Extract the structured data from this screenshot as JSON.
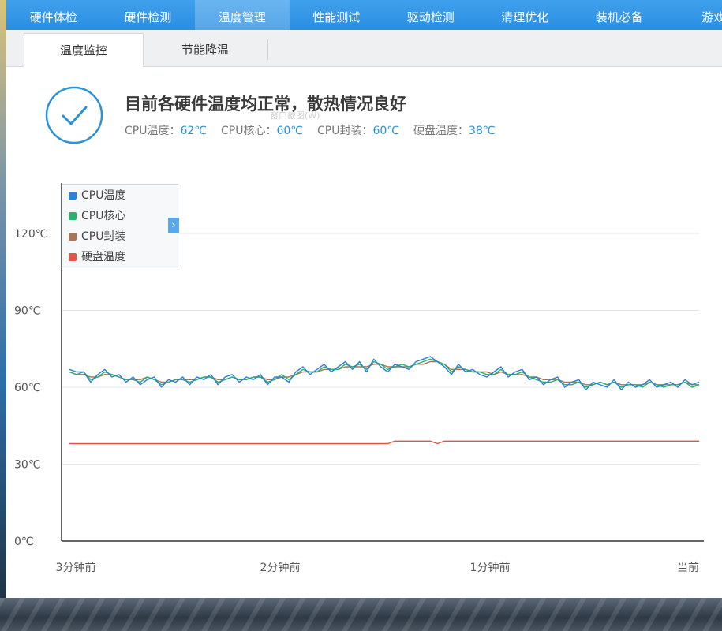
{
  "nav": {
    "items": [
      "硬件体检",
      "硬件检测",
      "温度管理",
      "性能测试",
      "驱动检测",
      "清理优化",
      "装机必备",
      "游戏"
    ],
    "active_index": 2
  },
  "subtabs": {
    "items": [
      "温度监控",
      "节能降温"
    ],
    "active_index": 0
  },
  "status": {
    "title": "目前各硬件温度均正常，散热情况良好",
    "readings": [
      {
        "label": "CPU温度：",
        "value": "62℃"
      },
      {
        "label": "CPU核心：",
        "value": "60℃"
      },
      {
        "label": "CPU封装：",
        "value": "60℃"
      },
      {
        "label": "硬盘温度：",
        "value": "38℃"
      }
    ],
    "accent_color": "#2a92d8",
    "watermark": "窗口截图(W)"
  },
  "chart_data": {
    "type": "line",
    "y_ticks": [
      "0℃",
      "30℃",
      "60℃",
      "90℃",
      "120℃"
    ],
    "ylim": [
      0,
      120
    ],
    "x_ticks": [
      "3分钟前",
      "2分钟前",
      "1分钟前",
      "当前"
    ],
    "grid": true,
    "legend_position": "top-left",
    "series": [
      {
        "name": "CPU温度",
        "color": "#2f7fd8",
        "values": [
          67,
          66,
          66,
          62,
          65,
          67,
          64,
          65,
          62,
          64,
          61,
          63,
          64,
          60,
          63,
          62,
          64,
          61,
          64,
          63,
          65,
          61,
          64,
          65,
          62,
          64,
          63,
          65,
          61,
          64,
          64,
          62,
          66,
          68,
          65,
          67,
          69,
          66,
          68,
          70,
          67,
          70,
          66,
          71,
          68,
          66,
          69,
          68,
          67,
          70,
          71,
          72,
          70,
          68,
          65,
          69,
          66,
          67,
          65,
          64,
          66,
          68,
          64,
          66,
          67,
          63,
          64,
          61,
          63,
          64,
          60,
          62,
          63,
          59,
          62,
          61,
          60,
          63,
          59,
          62,
          60,
          61,
          63,
          60,
          61,
          62,
          60,
          63,
          61,
          62
        ]
      },
      {
        "name": "CPU核心",
        "color": "#27b36b",
        "values": [
          66,
          65,
          66,
          63,
          64,
          66,
          65,
          64,
          63,
          63,
          62,
          64,
          63,
          61,
          62,
          63,
          63,
          62,
          63,
          64,
          64,
          62,
          63,
          64,
          63,
          63,
          64,
          64,
          62,
          63,
          65,
          63,
          65,
          67,
          66,
          66,
          68,
          67,
          67,
          69,
          68,
          69,
          67,
          70,
          69,
          67,
          68,
          69,
          68,
          69,
          70,
          71,
          70,
          69,
          66,
          68,
          67,
          66,
          66,
          65,
          65,
          67,
          65,
          65,
          66,
          64,
          63,
          62,
          62,
          63,
          61,
          61,
          62,
          60,
          61,
          62,
          61,
          62,
          60,
          61,
          61,
          60,
          62,
          61,
          60,
          61,
          61,
          62,
          60,
          61
        ]
      },
      {
        "name": "CPU封装",
        "color": "#a97555",
        "values": [
          66,
          65,
          65,
          64,
          64,
          65,
          65,
          64,
          63,
          63,
          63,
          64,
          63,
          62,
          62,
          63,
          63,
          63,
          63,
          64,
          64,
          63,
          63,
          64,
          63,
          63,
          64,
          64,
          63,
          63,
          64,
          64,
          65,
          66,
          66,
          66,
          67,
          67,
          67,
          68,
          68,
          68,
          68,
          69,
          69,
          68,
          68,
          68,
          68,
          69,
          69,
          70,
          70,
          69,
          67,
          67,
          67,
          66,
          66,
          66,
          65,
          66,
          65,
          65,
          65,
          64,
          64,
          63,
          63,
          63,
          62,
          62,
          62,
          61,
          61,
          62,
          61,
          62,
          61,
          61,
          61,
          61,
          62,
          61,
          61,
          61,
          61,
          62,
          61,
          61
        ]
      },
      {
        "name": "硬盘温度",
        "color": "#e2534a",
        "values": [
          38,
          38,
          38,
          38,
          38,
          38,
          38,
          38,
          38,
          38,
          38,
          38,
          38,
          38,
          38,
          38,
          38,
          38,
          38,
          38,
          38,
          38,
          38,
          38,
          38,
          38,
          38,
          38,
          38,
          38,
          38,
          38,
          38,
          38,
          38,
          38,
          38,
          38,
          38,
          38,
          38,
          38,
          38,
          38,
          38,
          38,
          39,
          39,
          39,
          39,
          39,
          39,
          38,
          39,
          39,
          39,
          39,
          39,
          39,
          39,
          39,
          39,
          39,
          39,
          39,
          39,
          39,
          39,
          39,
          39,
          39,
          39,
          39,
          39,
          39,
          39,
          39,
          39,
          39,
          39,
          39,
          39,
          39,
          39,
          39,
          39,
          39,
          39,
          39,
          39
        ]
      }
    ]
  }
}
